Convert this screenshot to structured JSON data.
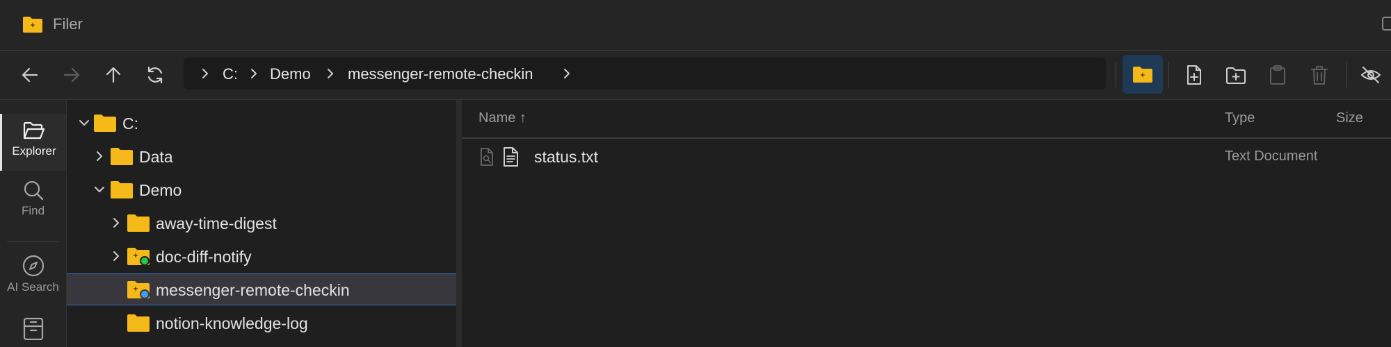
{
  "app": {
    "title": "Filer"
  },
  "address": {
    "segments": [
      "C:",
      "Demo",
      "messenger-remote-checkin"
    ]
  },
  "activity": {
    "items": [
      {
        "label": "Explorer",
        "icon": "folder-open-icon",
        "active": true
      },
      {
        "label": "Find",
        "icon": "search-icon"
      },
      {
        "label": "AI Search",
        "icon": "compass-icon"
      },
      {
        "label": "",
        "icon": "archive-icon"
      }
    ]
  },
  "tree": {
    "items": [
      {
        "label": "C:",
        "expanded": true
      },
      {
        "label": "Data",
        "expanded": false
      },
      {
        "label": "Demo",
        "expanded": true
      },
      {
        "label": "away-time-digest",
        "expanded": false
      },
      {
        "label": "doc-diff-notify",
        "expanded": false,
        "status_dot": "green"
      },
      {
        "label": "messenger-remote-checkin",
        "selected": true,
        "status_dot": "blue"
      },
      {
        "label": "notion-knowledge-log"
      }
    ]
  },
  "files": {
    "columns": {
      "name": "Name ↑",
      "type": "Type",
      "size": "Size"
    },
    "rows": [
      {
        "name": "status.txt",
        "type": "Text Document"
      }
    ]
  },
  "colors": {
    "folder": "#f5b919",
    "accent": "#3a76c4",
    "status_green": "#28c840",
    "status_blue": "#4a9cf0"
  }
}
